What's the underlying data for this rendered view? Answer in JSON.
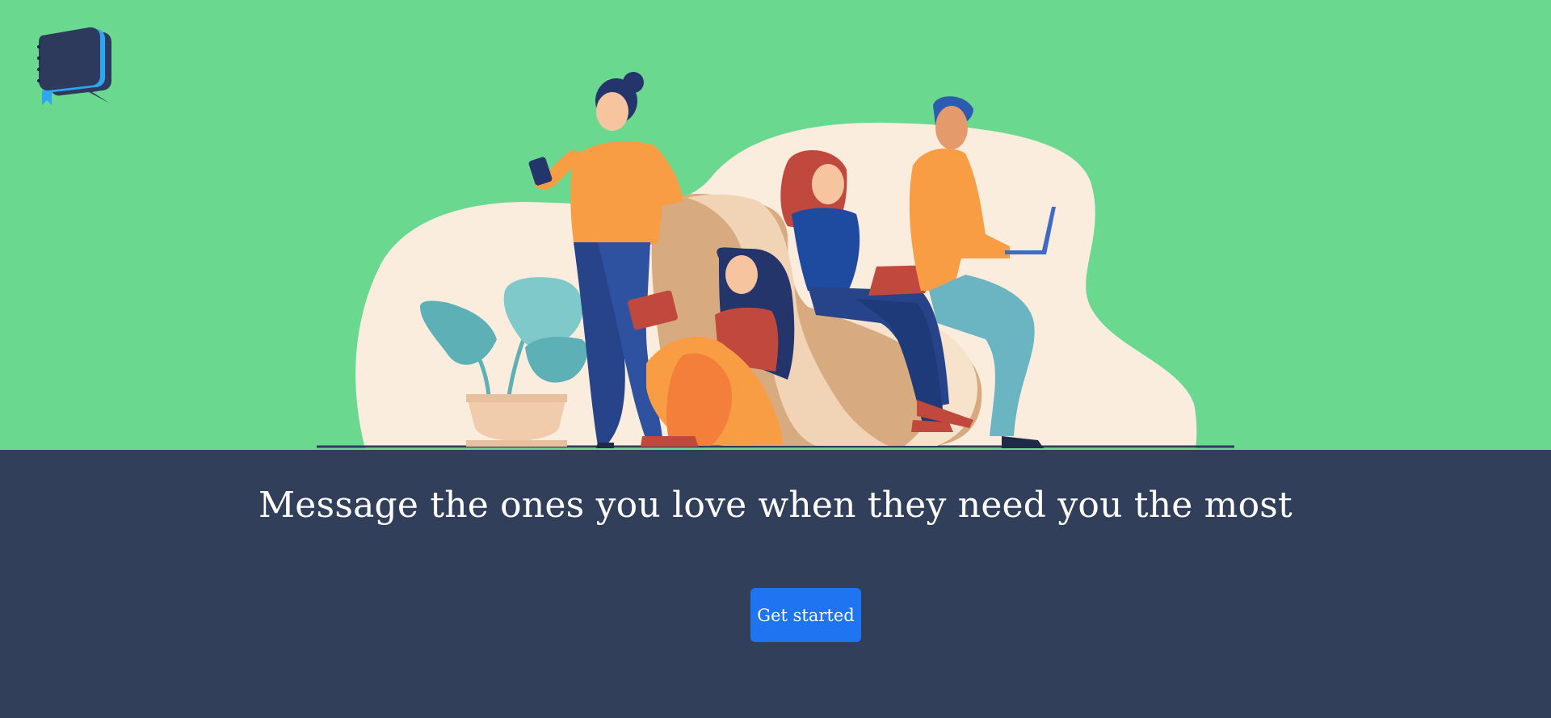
{
  "brand": {
    "logo_icon": "chat-notebook-logo-icon"
  },
  "hero": {
    "illustration": "people-using-devices-illustration"
  },
  "main": {
    "headline": "Message the ones you love when they need you the most",
    "cta_label": "Get started"
  },
  "colors": {
    "hero_background": "#6ad88f",
    "band_background": "#323f5b",
    "cta_background": "#1f74f1",
    "text": "#ffffff"
  }
}
